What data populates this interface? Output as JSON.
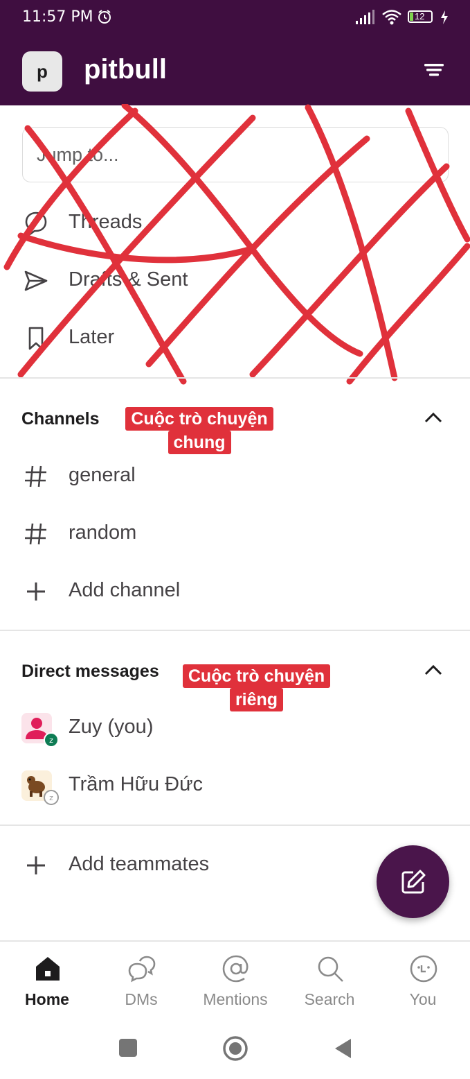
{
  "status_bar": {
    "time": "11:57 PM",
    "battery": "12"
  },
  "workspace": {
    "initial": "p",
    "name": "pitbull"
  },
  "jump": {
    "placeholder": "Jump to..."
  },
  "nav_items": [
    {
      "label": "Threads",
      "icon": "threads-icon"
    },
    {
      "label": "Drafts & Sent",
      "icon": "send-icon"
    },
    {
      "label": "Later",
      "icon": "bookmark-icon"
    }
  ],
  "channels": {
    "title": "Channels",
    "annotation": [
      "Cuộc trò chuyện",
      "chung"
    ],
    "items": [
      {
        "label": "general"
      },
      {
        "label": "random"
      }
    ],
    "add_label": "Add channel"
  },
  "direct_messages": {
    "title": "Direct messages",
    "annotation": [
      "Cuộc trò chuyện",
      "riêng"
    ],
    "items": [
      {
        "label": "Zuy (you)"
      },
      {
        "label": "Trầm Hữu Đức"
      }
    ]
  },
  "add_teammates": "Add teammates",
  "tabs": [
    {
      "label": "Home",
      "active": true
    },
    {
      "label": "DMs"
    },
    {
      "label": "Mentions"
    },
    {
      "label": "Search"
    },
    {
      "label": "You"
    }
  ],
  "colors": {
    "brand": "#3f0e40",
    "annotation": "#e0313b",
    "fab": "#4a154b"
  }
}
